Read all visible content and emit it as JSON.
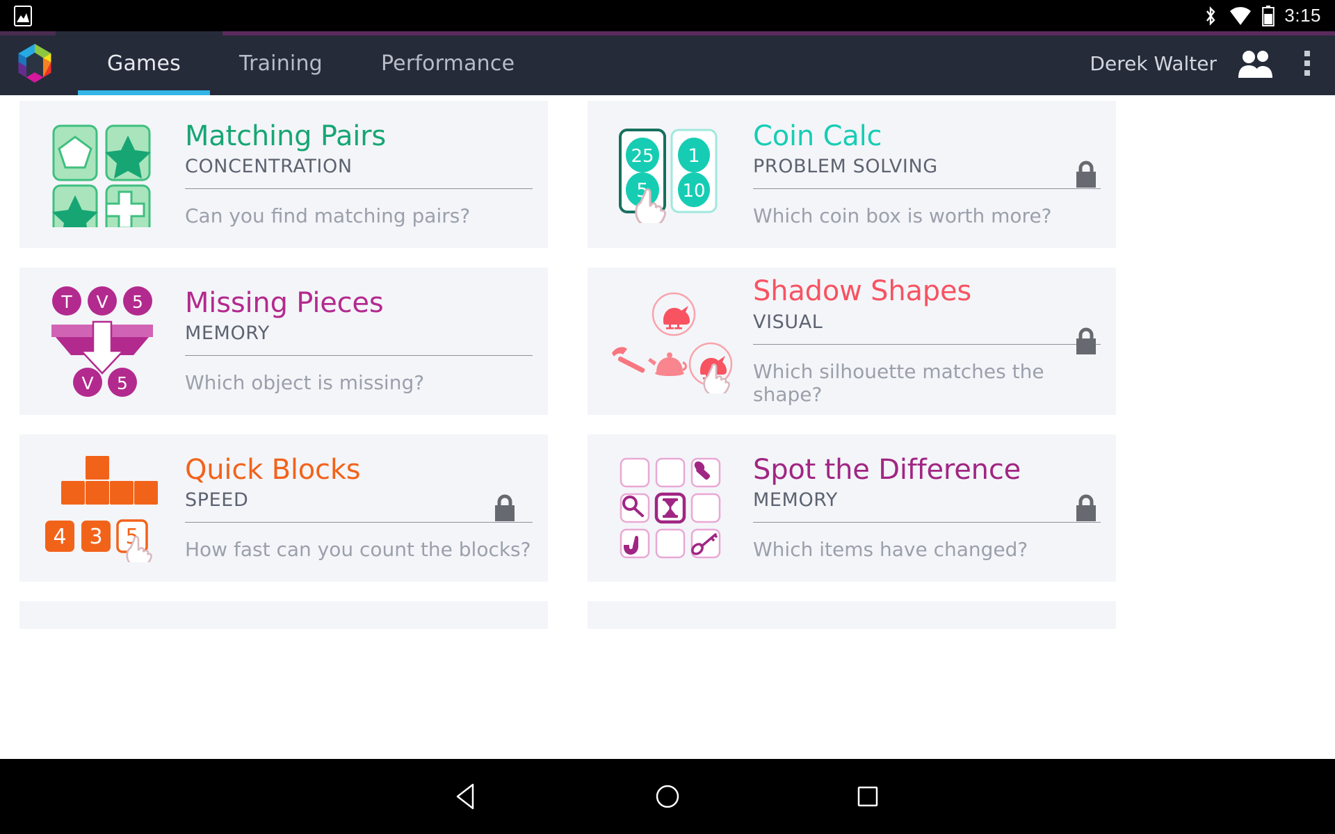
{
  "statusbar": {
    "time": "3:15",
    "icons": [
      "screenshot-icon",
      "bluetooth-icon",
      "wifi-icon",
      "battery-icon"
    ]
  },
  "appbar": {
    "logo_name": "peak-logo",
    "tabs": [
      {
        "label": "Games",
        "active": true
      },
      {
        "label": "Training",
        "active": false
      },
      {
        "label": "Performance",
        "active": false
      }
    ],
    "username": "Derek Walter",
    "friends_icon": "friends-icon",
    "overflow_icon": "overflow-menu-icon",
    "accent_color": "#33b5e5",
    "bg_color": "#262b3a"
  },
  "cards": [
    {
      "title": "Matching Pairs",
      "category": "CONCENTRATION",
      "description": "Can you find matching pairs?",
      "color": "#17a673",
      "locked": false,
      "icon": "matching-pairs-icon"
    },
    {
      "title": "Coin Calc",
      "category": "PROBLEM SOLVING",
      "description": "Which coin box is worth more?",
      "color": "#16cdb4",
      "locked": true,
      "icon": "coin-calc-icon",
      "coins_left": [
        "25",
        "5"
      ],
      "coins_right": [
        "1",
        "10"
      ]
    },
    {
      "title": "Missing Pieces",
      "category": "MEMORY",
      "description": "Which object is missing?",
      "color": "#b32a8e",
      "locked": false,
      "icon": "missing-pieces-icon",
      "tokens_top": [
        "T",
        "V",
        "5"
      ],
      "tokens_bottom": [
        "V",
        "5"
      ]
    },
    {
      "title": "Shadow Shapes",
      "category": "VISUAL",
      "description": "Which silhouette matches the shape?",
      "color": "#f75361",
      "locked": true,
      "icon": "shadow-shapes-icon",
      "objects": [
        "duck-icon",
        "hammer-icon",
        "teapot-icon",
        "duck-icon"
      ]
    },
    {
      "title": "Quick Blocks",
      "category": "SPEED",
      "description": "How fast can you count the blocks?",
      "color": "#f2631a",
      "locked": true,
      "icon": "quick-blocks-icon",
      "answers": [
        "4",
        "3",
        "5"
      ],
      "selected_answer": "5"
    },
    {
      "title": "Spot the Difference",
      "category": "MEMORY",
      "description": "Which items have changed?",
      "color": "#a02683",
      "locked": true,
      "icon": "spot-the-difference-icon",
      "grid": [
        "",
        "",
        "flashlight-icon",
        "magnifier-icon",
        "hourglass-icon",
        "",
        "pipe-icon",
        "",
        "key-icon"
      ],
      "highlighted_cell": "hourglass-icon"
    }
  ],
  "navbar": {
    "back": "back-triangle-icon",
    "home": "home-circle-icon",
    "recents": "recents-square-icon"
  }
}
